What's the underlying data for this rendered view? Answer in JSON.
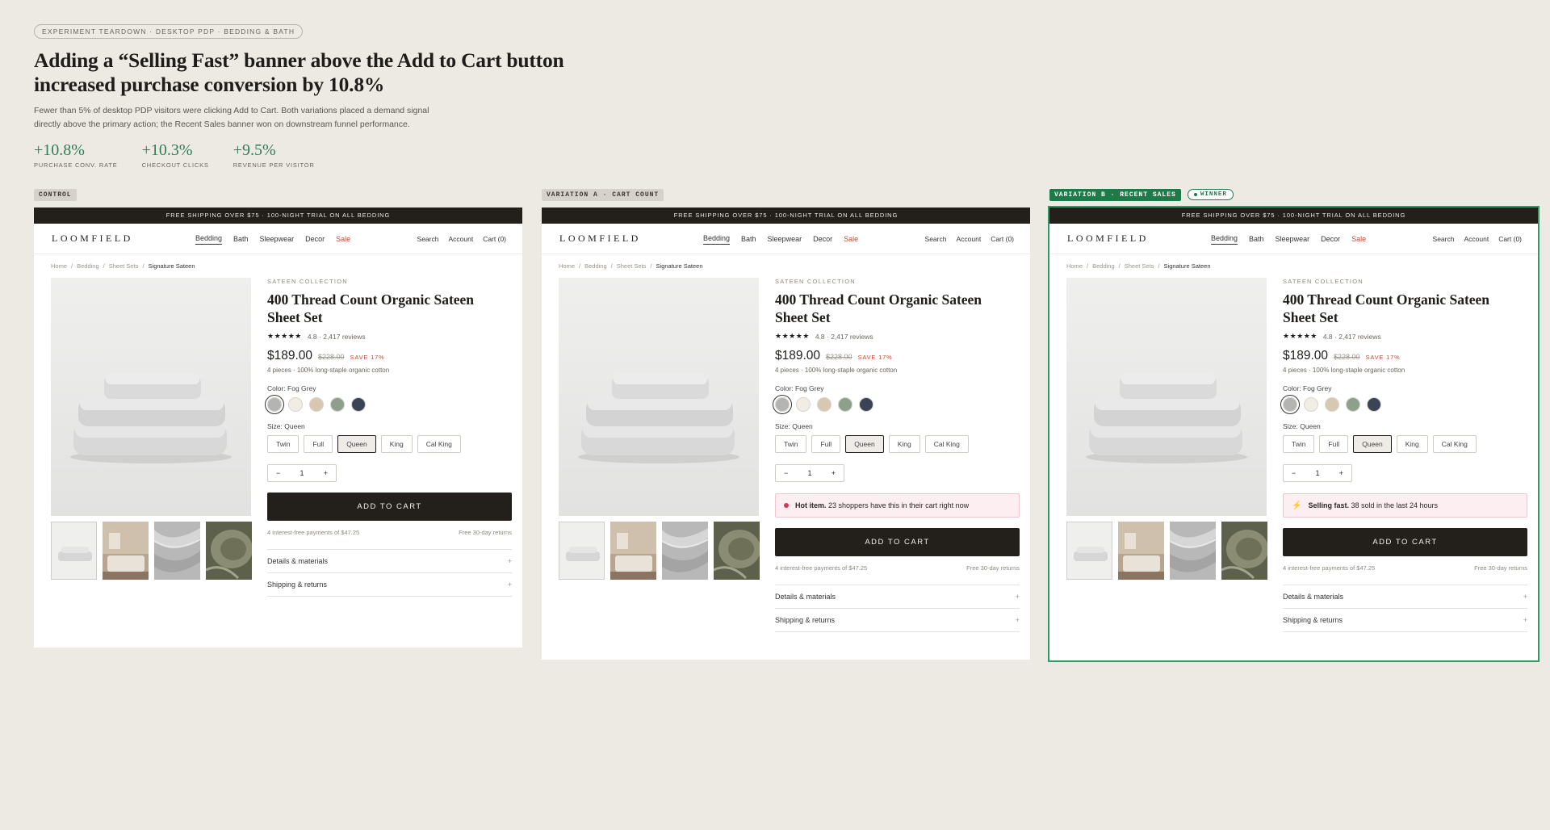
{
  "header": {
    "chip": "EXPERIMENT TEARDOWN · DESKTOP PDP · BEDDING & BATH",
    "title_line1": "Adding a “Selling Fast” banner above the Add to Cart button",
    "title_line2": "increased purchase conversion by 10.8%",
    "desc_line1": "Fewer than 5% of desktop PDP visitors were clicking Add to Cart. Both variations placed a demand signal",
    "desc_line2": "directly above the primary action; the Recent Sales banner won on downstream funnel performance.",
    "metrics": [
      {
        "value": "+10.8%",
        "label": "PURCHASE CONV. RATE"
      },
      {
        "value": "+10.3%",
        "label": "CHECKOUT CLICKS"
      },
      {
        "value": "+9.5%",
        "label": "REVENUE PER VISITOR"
      }
    ]
  },
  "pdp": {
    "shipping_bar": "FREE SHIPPING OVER $75 · 100-NIGHT TRIAL ON ALL BEDDING",
    "logo": "LOOMFIELD",
    "nav": [
      "Bedding",
      "Bath",
      "Sleepwear",
      "Decor",
      "Sale"
    ],
    "util": [
      "Search",
      "Account",
      "Cart (0)"
    ],
    "crumbs": [
      "Home",
      "/",
      "Bedding",
      "/",
      "Sheet Sets",
      "/",
      "Signature Sateen"
    ],
    "collection": "SATEEN COLLECTION",
    "name_line1": "400 Thread Count Organic Sateen",
    "name_line2": "Sheet Set",
    "stars": "★★★★★",
    "rating": "4.8 · 2,417 reviews",
    "price": "$189.00",
    "was": "$228.00",
    "save": "SAVE 17%",
    "pieces": "4 pieces · 100% long-staple organic cotton",
    "color_label": "Color: Fog Grey",
    "swatch_colors": [
      "#b4b4b2",
      "#f1ede4",
      "#d8c8b2",
      "#8ea08c",
      "#3b4356"
    ],
    "size_label": "Size: Queen",
    "sizes": [
      "Twin",
      "Full",
      "Queen",
      "King",
      "Cal King"
    ],
    "qty": {
      "minus": "−",
      "value": "1",
      "plus": "+"
    },
    "atc": "ADD TO CART",
    "payments": "4 interest-free payments of $47.25",
    "returns": "Free 30-day returns",
    "accordion": [
      "Details & materials",
      "Shipping & returns"
    ],
    "plus": "+"
  },
  "variants": [
    {
      "tag": "CONTROL"
    },
    {
      "tag": "VARIATION A · CART COUNT",
      "banner_bold": "Hot item.",
      "banner_text": "23 shoppers have this in their cart right now",
      "banner_icon": "pink-dot-icon"
    },
    {
      "tag": "VARIATION B · RECENT SALES",
      "winner": "WINNER",
      "banner_bold": "Selling fast.",
      "banner_text": "38 sold in the last 24 hours",
      "banner_icon": "bolt-icon"
    }
  ]
}
